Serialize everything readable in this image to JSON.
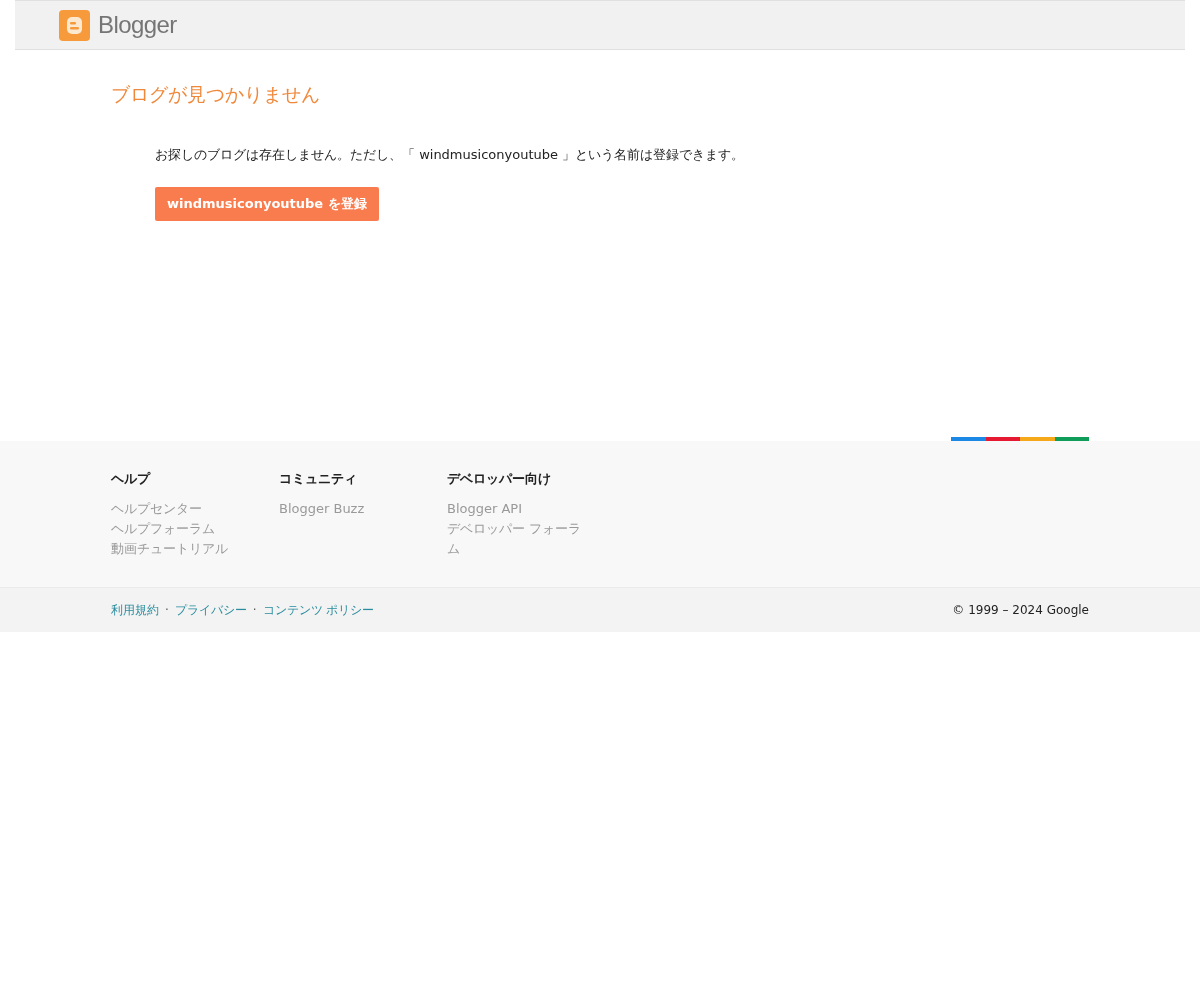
{
  "header": {
    "logo_text": "Blogger"
  },
  "title": "ブログが見つかりません",
  "message": "お探しのブログは存在しません。ただし、「 windmusiconyoutube 」という名前は登録できます。",
  "register_button": "windmusiconyoutube を登録",
  "footer_columns": [
    {
      "heading": "ヘルプ",
      "links": [
        "ヘルプセンター",
        "ヘルプフォーラム",
        "動画チュートリアル"
      ]
    },
    {
      "heading": "コミュニティ",
      "links": [
        "Blogger Buzz"
      ]
    },
    {
      "heading": "デベロッパー向け",
      "links": [
        "Blogger API",
        "デベロッパー フォーラム"
      ]
    }
  ],
  "legal_links": [
    "利用規約",
    "プライバシー",
    "コンテンツ ポリシー"
  ],
  "legal_separator": "·",
  "copyright": "© 1999 – 2024 Google"
}
